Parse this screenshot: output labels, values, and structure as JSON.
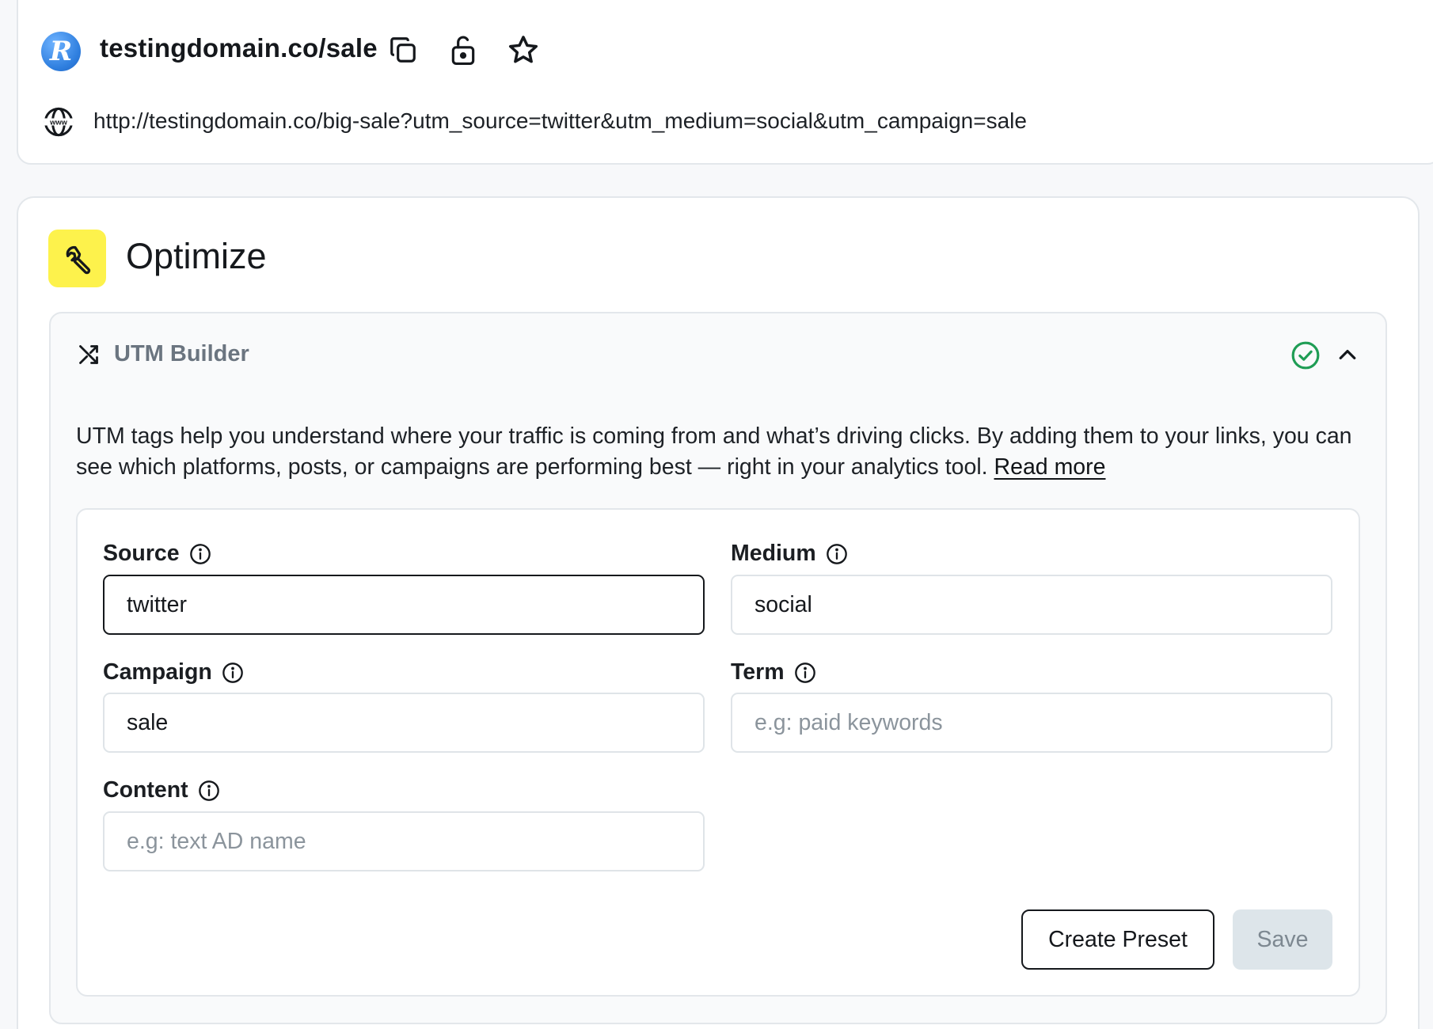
{
  "link": {
    "brand_letter": "R",
    "short_url": "testingdomain.co/sale",
    "destination_url": "http://testingdomain.co/big-sale?utm_source=twitter&utm_medium=social&utm_campaign=sale",
    "icons": [
      "copy-icon",
      "unlock-icon",
      "star-icon",
      "globe-icon"
    ]
  },
  "optimize": {
    "title": "Optimize",
    "icon": "wrench-icon",
    "accent_color": "#fdf24c"
  },
  "utm_builder": {
    "title": "UTM Builder",
    "status_icon": "check-circle-icon",
    "status_color": "#1f9d55",
    "description": "UTM tags help you understand where your traffic is coming from and what’s driving clicks. By adding them to your links, you can see which platforms, posts, or campaigns are performing best — right in your analytics tool.",
    "read_more": "Read more",
    "fields": {
      "source": {
        "label": "Source",
        "value": "twitter",
        "placeholder": ""
      },
      "medium": {
        "label": "Medium",
        "value": "social",
        "placeholder": ""
      },
      "campaign": {
        "label": "Campaign",
        "value": "sale",
        "placeholder": ""
      },
      "term": {
        "label": "Term",
        "value": "",
        "placeholder": "e.g: paid keywords"
      },
      "content": {
        "label": "Content",
        "value": "",
        "placeholder": "e.g: text AD name"
      }
    },
    "buttons": {
      "create_preset": "Create Preset",
      "save": "Save"
    }
  }
}
